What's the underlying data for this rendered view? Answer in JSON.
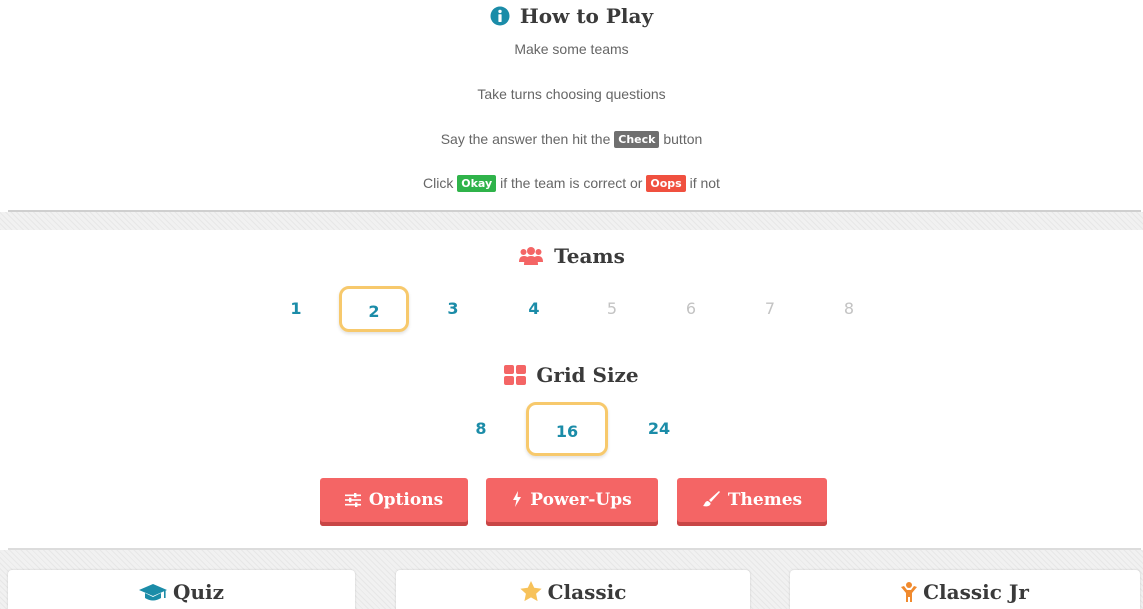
{
  "how_to_play": {
    "title": "How to Play",
    "title_icon": "info-circle-icon",
    "step1": "Make some teams",
    "step2": "Take turns choosing questions",
    "step3_before": "Say the answer then hit the",
    "step3_chip": "Check",
    "step3_after": "button",
    "step4_before": "Click",
    "step4_chip_okay": "Okay",
    "step4_middle": "if the team is correct or",
    "step4_chip_oops": "Oops",
    "step4_after": "if not"
  },
  "teams": {
    "title": "Teams",
    "title_icon": "users-icon",
    "options": [
      "1",
      "2",
      "3",
      "4",
      "5",
      "6",
      "7",
      "8"
    ],
    "selected": "2"
  },
  "grid_size": {
    "title": "Grid Size",
    "title_icon": "grid-icon",
    "options": [
      "8",
      "16",
      "24"
    ],
    "selected": "16"
  },
  "buttons": {
    "options": "Options",
    "power_ups": "Power-Ups",
    "themes": "Themes"
  },
  "modes": {
    "quiz": "Quiz",
    "classic": "Classic",
    "classic_jr": "Classic Jr"
  },
  "colors": {
    "accent_red": "#f46565",
    "teal": "#1b8ca8",
    "selected_ring": "#f7c96c",
    "check": "#6f6f6f",
    "okay": "#2fb34a",
    "oops": "#f0503f"
  }
}
